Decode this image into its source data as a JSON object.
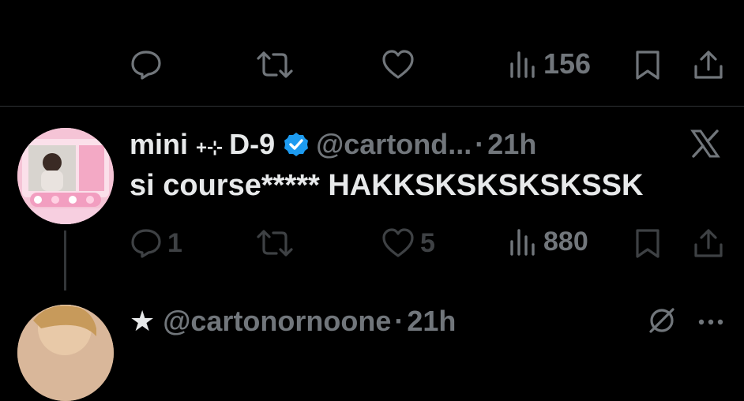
{
  "top_actions": {
    "views": "156"
  },
  "tweet": {
    "display_name": "mini",
    "name_sparkle": "+⊹",
    "name_suffix": "D-9",
    "handle": "@cartond...",
    "separator": "·",
    "time": "21h",
    "text": "si course***** HAKKSKSKSKSKSSK",
    "replies": "1",
    "likes": "5",
    "views": "880"
  },
  "next_tweet": {
    "star": "★",
    "handle": "@cartonornoone",
    "separator": "·",
    "time": "21h"
  },
  "colors": {
    "background": "#000000",
    "text_primary": "#e7e9ea",
    "text_secondary": "#71767b",
    "verified_blue": "#1d9bf0",
    "divider": "#2f3336"
  },
  "icons": [
    "reply-icon",
    "retweet-icon",
    "like-icon",
    "views-icon",
    "bookmark-icon",
    "share-icon",
    "verified-badge-icon",
    "x-logo-icon",
    "more-icon",
    "grok-icon"
  ]
}
